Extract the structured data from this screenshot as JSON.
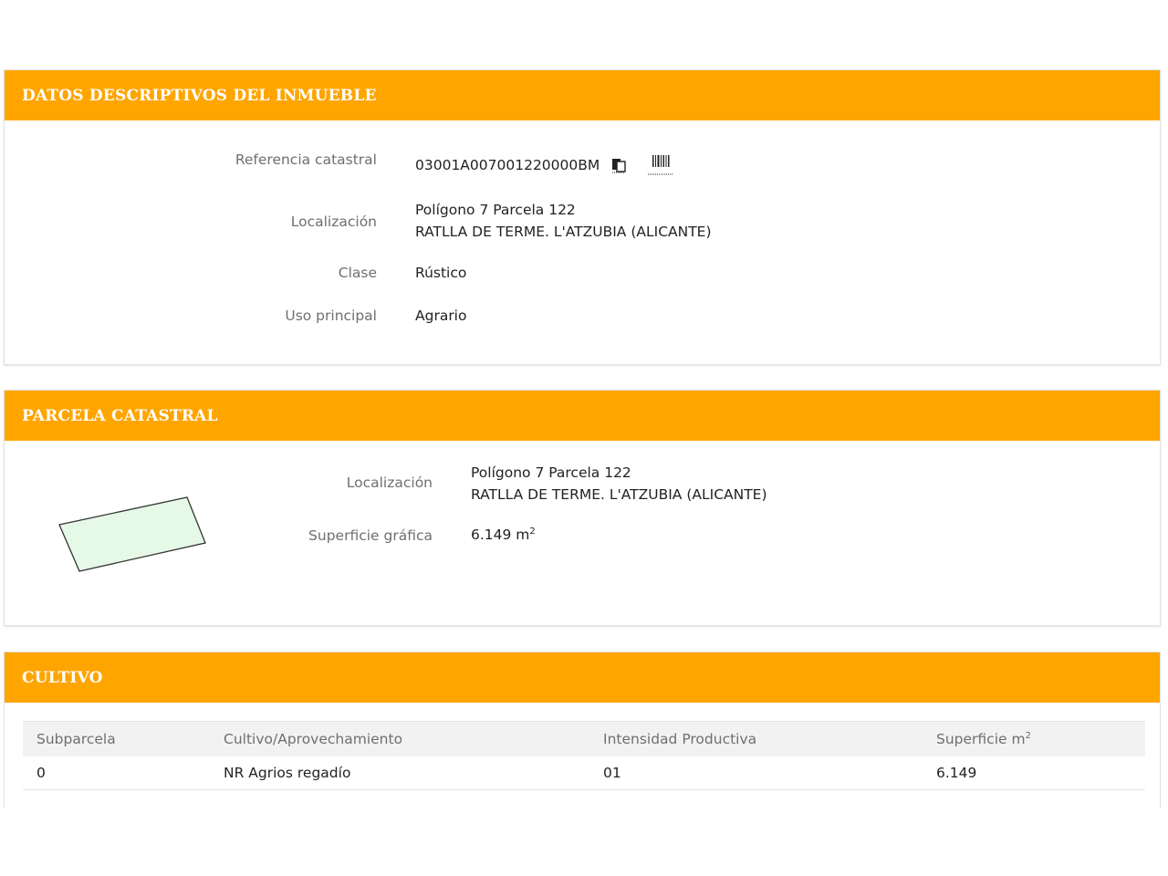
{
  "colors": {
    "header_bg": "#ffa500",
    "label": "#6f6f6f",
    "parcel_fill": "#e6f8e6"
  },
  "datos": {
    "title": "DATOS DESCRIPTIVOS DEL INMUEBLE",
    "ref_label": "Referencia catastral",
    "ref_value": "03001A007001220000BM",
    "copy_icon": "copy-icon",
    "barcode_icon": "barcode-icon",
    "loc_label": "Localización",
    "loc_line1": "Polígono 7 Parcela 122",
    "loc_line2": "RATLLA DE TERME. L'ATZUBIA (ALICANTE)",
    "clase_label": "Clase",
    "clase_value": "Rústico",
    "uso_label": "Uso principal",
    "uso_value": "Agrario"
  },
  "parcela": {
    "title": "PARCELA CATASTRAL",
    "loc_label": "Localización",
    "loc_line1": "Polígono 7 Parcela 122",
    "loc_line2": "RATLLA DE TERME. L'ATZUBIA (ALICANTE)",
    "sup_label": "Superficie gráfica",
    "sup_value": "6.149 m",
    "sup_exp": "2"
  },
  "cultivo": {
    "title": "CULTIVO",
    "headers": [
      "Subparcela",
      "Cultivo/Aprovechamiento",
      "Intensidad Productiva",
      "Superficie m"
    ],
    "header_exp": "2",
    "rows": [
      [
        "0",
        "NR Agrios regadío",
        "01",
        "6.149"
      ]
    ]
  }
}
